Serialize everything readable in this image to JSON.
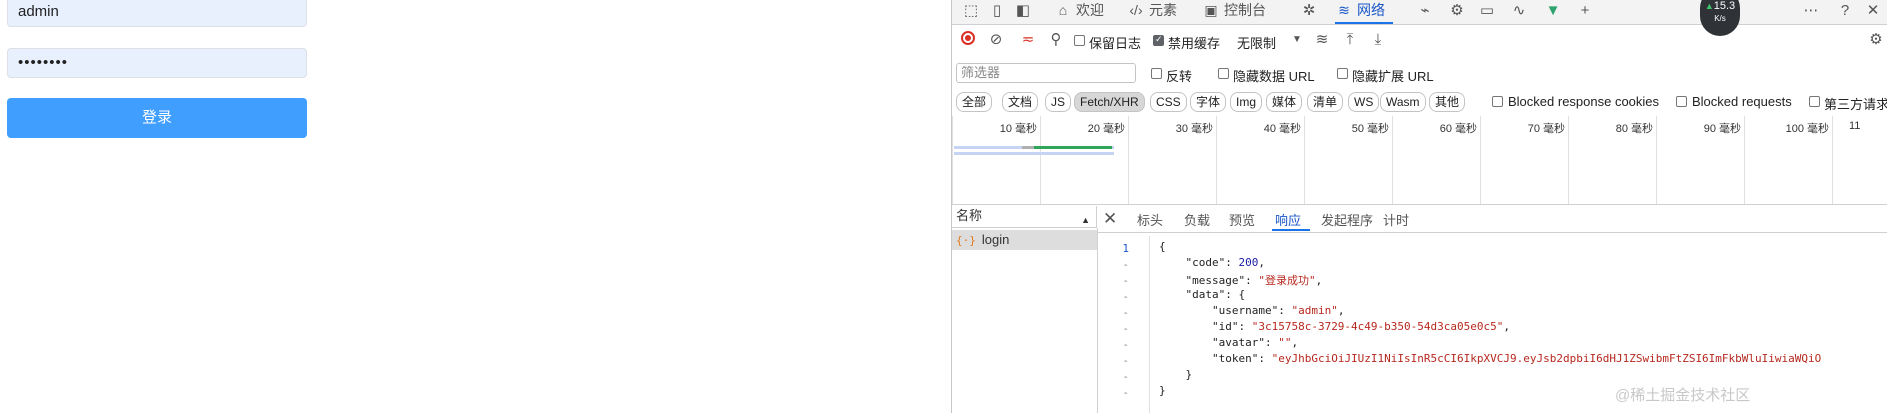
{
  "login": {
    "username_value": "admin",
    "password_value": "••••••••",
    "submit_label": "登录"
  },
  "devtools": {
    "tabs": [
      {
        "icon": "welcome-icon",
        "label": "欢迎"
      },
      {
        "icon": "elements-icon",
        "label": "元素"
      },
      {
        "icon": "console-icon",
        "label": "控制台"
      },
      {
        "icon": "network-icon",
        "label": "网络"
      }
    ],
    "network_speed": "15.3",
    "network_speed_unit": "K/s",
    "toolbar": {
      "preserve_log": "保留日志",
      "disable_cache": "禁用缓存",
      "throttling": "无限制"
    },
    "filter": {
      "placeholder": "筛选器",
      "invert": "反转",
      "hide_data_urls": "隐藏数据 URL",
      "hide_ext_urls": "隐藏扩展 URL"
    },
    "type_chips": [
      "全部",
      "文档",
      "JS",
      "Fetch/XHR",
      "CSS",
      "字体",
      "Img",
      "媒体",
      "清单",
      "WS",
      "Wasm",
      "其他"
    ],
    "selected_chip": "Fetch/XHR",
    "blocked_cookies": "Blocked response cookies",
    "blocked_requests": "Blocked requests",
    "third_party": "第三方请求",
    "timeline_ticks": [
      "10 毫秒",
      "20 毫秒",
      "30 毫秒",
      "40 毫秒",
      "50 毫秒",
      "60 毫秒",
      "70 毫秒",
      "80 毫秒",
      "90 毫秒",
      "100 毫秒",
      "11"
    ],
    "names_header": "名称",
    "request_name": "login",
    "detail_tabs": [
      "标头",
      "负载",
      "预览",
      "响应",
      "发起程序",
      "计时"
    ],
    "active_detail_tab": "响应",
    "response": {
      "code": "200",
      "message": "\"登录成功\"",
      "username": "\"admin\"",
      "id": "\"3c15758c-3729-4c49-b350-54d3ca05e0c5\"",
      "avatar": "\"\"",
      "token": "\"eyJhbGciOiJIUzI1NiIsInR5cCI6IkpXVCJ9.eyJsb2dpbiI6dHJ1ZSwibmFtZSI6ImFkbWluIiwiaWQiO"
    },
    "gutter_numbers": [
      "1",
      "-",
      "-",
      "-",
      "-",
      "-",
      "-",
      "-",
      "-",
      "-"
    ],
    "watermark": "@稀土掘金技术社区"
  }
}
